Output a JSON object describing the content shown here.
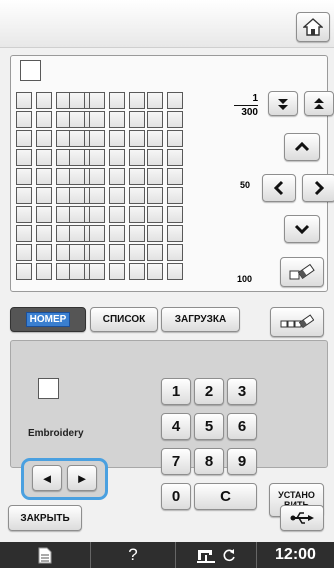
{
  "top_bar": {
    "home_icon": "home-icon"
  },
  "selection_indicator": "",
  "grid": {
    "rows": 10,
    "cols": 10,
    "page_number": "1",
    "page_total": "300",
    "marker_50": "50",
    "marker_100": "100"
  },
  "tabs": [
    {
      "label": "НОМЕР",
      "active": true
    },
    {
      "label": "СПИСОК",
      "active": false
    },
    {
      "label": "ЗАГРУЗКА",
      "active": false
    }
  ],
  "panel": {
    "category_label": "Embroidery",
    "left_arrow": "◄",
    "right_arrow": "►"
  },
  "keypad": {
    "keys": [
      "1",
      "2",
      "3",
      "4",
      "5",
      "6",
      "7",
      "8",
      "9"
    ],
    "zero": "0",
    "clear": "C",
    "set_line1": "УСТАНО",
    "set_line2": "ВИТЬ"
  },
  "bottom": {
    "close_label": "ЗАКРЫТЬ",
    "usb_icon": "usb-icon"
  },
  "status_bar": {
    "time": "12:00",
    "help": "?"
  },
  "colors": {
    "accent_blue": "#4aa0e0",
    "status_bg": "#2e2e2e",
    "panel_bg": "#d3d3d3"
  }
}
